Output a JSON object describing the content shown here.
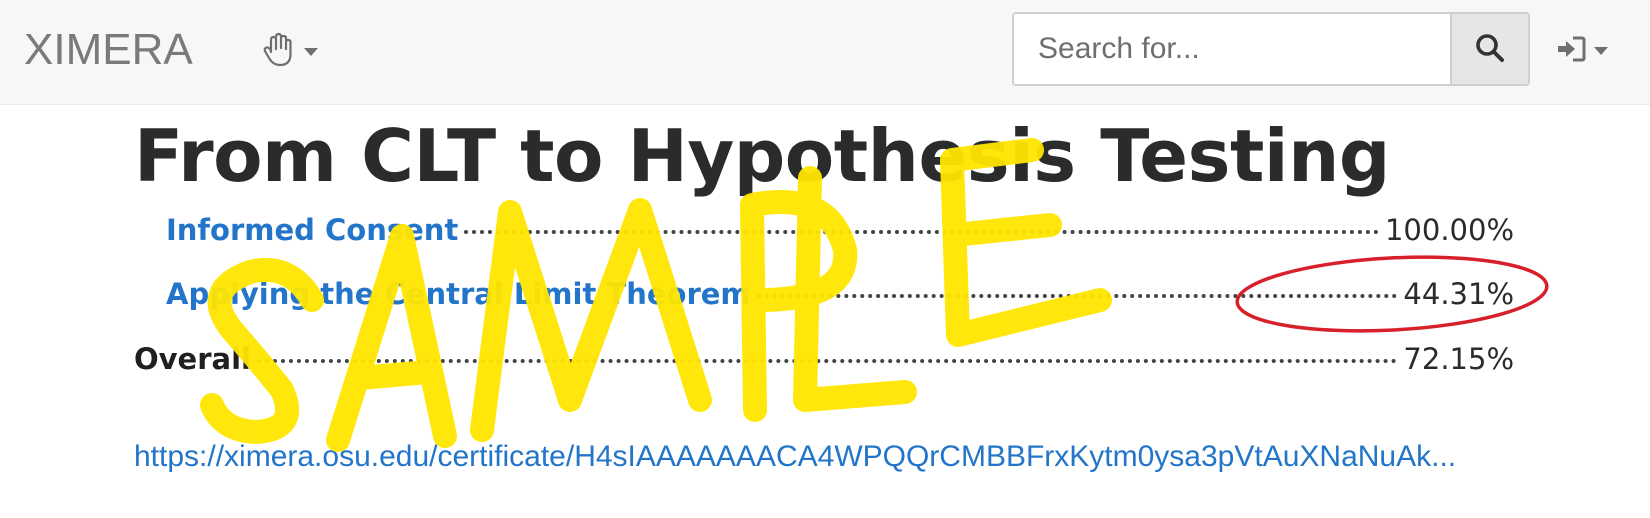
{
  "header": {
    "brand": "XIMERA",
    "search": {
      "placeholder": "Search for...",
      "value": ""
    },
    "icons": {
      "tool": "hand-pointer-icon",
      "search": "search-icon",
      "login": "sign-in-icon"
    }
  },
  "main": {
    "title": "From CLT to Hypothesis Testing",
    "activities": [
      {
        "label": "Informed Consent",
        "percent": "100.00%"
      },
      {
        "label": "Applying the Central Limit Theorem",
        "percent": "44.31%"
      }
    ],
    "overall": {
      "label": "Overall",
      "percent": "72.15%"
    },
    "certificate_url": "https://ximera.osu.edu/certificate/H4sIAAAAAAACA4WPQQrCMBBFrxKytm0ysa3pVtAuXNaNuAk..."
  },
  "watermark": {
    "text": "SAMPLE",
    "color": "#ffe600"
  },
  "annotation": {
    "circle_color": "#d8202a"
  },
  "colors": {
    "link": "#2275c8",
    "nav_bg": "#f7f7f7"
  }
}
